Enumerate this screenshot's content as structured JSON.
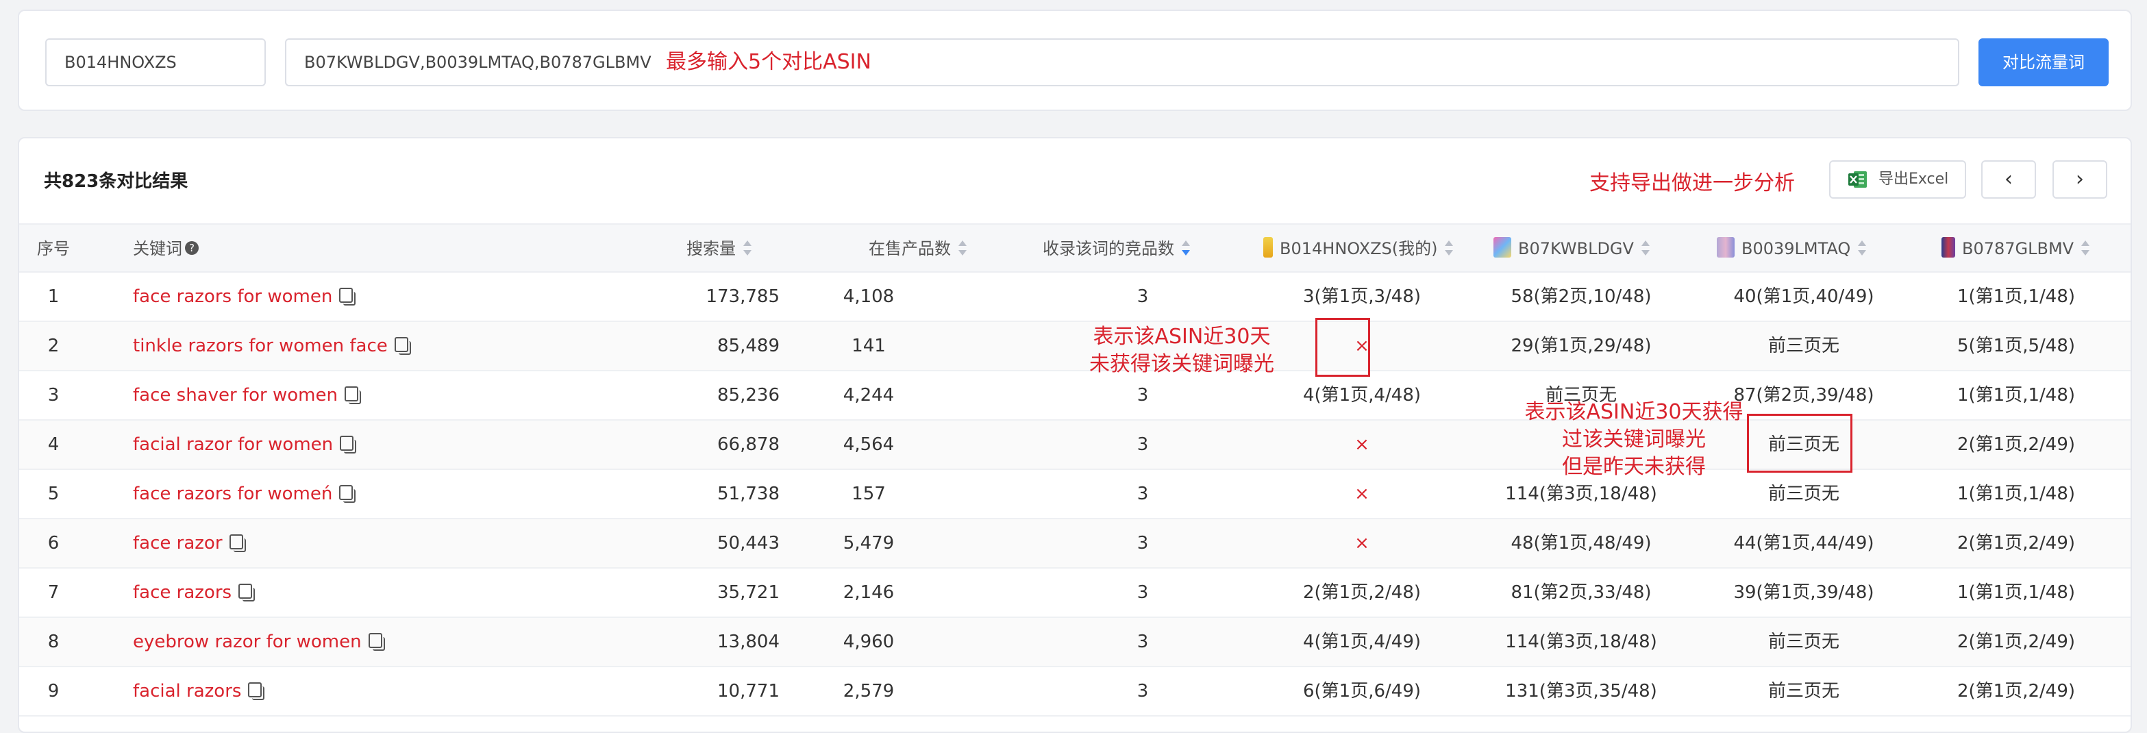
{
  "search": {
    "asin_value": "B014HNOXZS",
    "compare_value": "B07KWBLDGV,B0039LMTAQ,B0787GLBMV",
    "compare_hint": "最多输入5个对比ASIN",
    "submit_label": "对比流量词"
  },
  "results": {
    "summary": "共823条对比结果",
    "export_hint": "支持导出做进一步分析",
    "export_label": "导出Excel",
    "prev_label": "‹",
    "next_label": "›"
  },
  "table": {
    "headers": {
      "index": "序号",
      "keyword": "关键词",
      "help": "?",
      "volume": "搜索量",
      "products": "在售产品数",
      "competitors": "收录该词的竞品数",
      "asin1": "B014HNOXZS(我的)",
      "asin2": "B07KWBLDGV",
      "asin3": "B0039LMTAQ",
      "asin4": "B0787GLBMV"
    },
    "rows": [
      {
        "index": "1",
        "keyword": "face razors for women",
        "volume": "173,785",
        "products": "4,108",
        "competitors": "3",
        "a1": "3(第1页,3/48)",
        "a2": "58(第2页,10/48)",
        "a3": "40(第1页,40/49)",
        "a4": "1(第1页,1/48)"
      },
      {
        "index": "2",
        "keyword": "tinkle razors for women face",
        "volume": "85,489",
        "products": "141",
        "competitors": "",
        "a1": "×",
        "a2": "29(第1页,29/48)",
        "a3": "前三页无",
        "a4": "5(第1页,5/48)"
      },
      {
        "index": "3",
        "keyword": "face shaver for women",
        "volume": "85,236",
        "products": "4,244",
        "competitors": "3",
        "a1": "4(第1页,4/48)",
        "a2": "前三页无",
        "a3": "87(第2页,39/48)",
        "a4": "1(第1页,1/48)"
      },
      {
        "index": "4",
        "keyword": "facial razor for women",
        "volume": "66,878",
        "products": "4,564",
        "competitors": "3",
        "a1": "×",
        "a2": "",
        "a3": "前三页无",
        "a4": "2(第1页,2/49)"
      },
      {
        "index": "5",
        "keyword": "face razors for womeń",
        "volume": "51,738",
        "products": "157",
        "competitors": "3",
        "a1": "×",
        "a2": "114(第3页,18/48)",
        "a3": "前三页无",
        "a4": "1(第1页,1/48)"
      },
      {
        "index": "6",
        "keyword": "face razor",
        "volume": "50,443",
        "products": "5,479",
        "competitors": "3",
        "a1": "×",
        "a2": "48(第1页,48/49)",
        "a3": "44(第1页,44/49)",
        "a4": "2(第1页,2/49)"
      },
      {
        "index": "7",
        "keyword": "face razors",
        "volume": "35,721",
        "products": "2,146",
        "competitors": "3",
        "a1": "2(第1页,2/48)",
        "a2": "81(第2页,33/48)",
        "a3": "39(第1页,39/48)",
        "a4": "1(第1页,1/48)"
      },
      {
        "index": "8",
        "keyword": "eyebrow razor for women",
        "volume": "13,804",
        "products": "4,960",
        "competitors": "3",
        "a1": "4(第1页,4/49)",
        "a2": "114(第3页,18/48)",
        "a3": "前三页无",
        "a4": "2(第1页,2/49)"
      },
      {
        "index": "9",
        "keyword": "facial razors",
        "volume": "10,771",
        "products": "2,579",
        "competitors": "3",
        "a1": "6(第1页,6/49)",
        "a2": "131(第3页,35/48)",
        "a3": "前三页无",
        "a4": "2(第1页,2/49)"
      }
    ]
  },
  "annotations": {
    "not_exposed_line1": "表示该ASIN近30天",
    "not_exposed_line2": "未获得该关键词曝光",
    "yesterday_line1": "表示该ASIN近30天获得",
    "yesterday_line2": "过该关键词曝光",
    "yesterday_line3": "但是昨天未获得"
  },
  "colors": {
    "primary": "#3a86f4",
    "keyword_red": "#d9232d",
    "annotation_red": "#d9232d"
  },
  "icons": [
    "help-icon",
    "copy-icon",
    "excel-icon",
    "sort-icon",
    "chevron-left-icon",
    "chevron-right-icon"
  ]
}
